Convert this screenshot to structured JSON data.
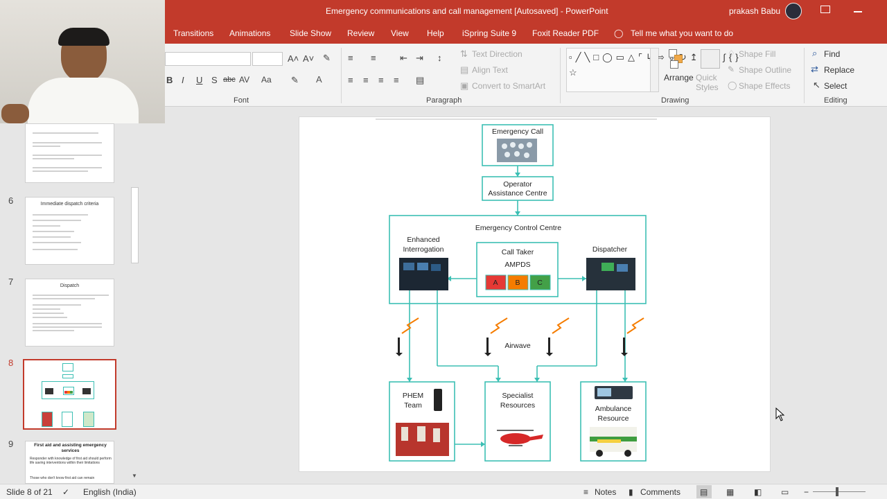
{
  "window": {
    "title": "Emergency communications and call management [Autosaved]  -  PowerPoint",
    "user": "prakash Babu"
  },
  "tabs": [
    "Transitions",
    "Animations",
    "Slide Show",
    "Review",
    "View",
    "Help",
    "iSpring Suite 9",
    "Foxit Reader PDF"
  ],
  "tell_me": "Tell me what you want to do",
  "ribbon": {
    "font_group": "Font",
    "paragraph_group": "Paragraph",
    "drawing_group": "Drawing",
    "editing_group": "Editing",
    "text_direction": "Text Direction",
    "align_text": "Align Text",
    "convert_smartart": "Convert to SmartArt",
    "arrange": "Arrange",
    "quick_styles": "Quick Styles",
    "shape_fill": "Shape Fill",
    "shape_outline": "Shape Outline",
    "shape_effects": "Shape Effects",
    "find": "Find",
    "replace": "Replace",
    "select": "Select",
    "bold": "B",
    "italic": "I",
    "underline": "U",
    "strike": "S",
    "abc": "abc",
    "spacing": "AV",
    "case": "Aa"
  },
  "thumbnails": {
    "numbers": [
      "6",
      "7",
      "8",
      "9"
    ],
    "slide6_title": "Immediate dispatch criteria",
    "slide7_title": "Dispatch",
    "slide9_title": "First aid and assisting emergency services",
    "slide9_bullet1": "Responder with knowledge of first aid should perform life saving interventions within their limitations",
    "slide9_bullet2": "Those who don't know first aid can remain"
  },
  "diagram": {
    "emergency_call": "Emergency Call",
    "operator_1": "Operator",
    "operator_2": "Assistance Centre",
    "ecc": "Emergency Control Centre",
    "enhanced_1": "Enhanced",
    "enhanced_2": "Interrogation",
    "call_taker": "Call Taker",
    "ampds": "AMPDS",
    "cat_a": "A",
    "cat_b": "B",
    "cat_c": "C",
    "dispatcher": "Dispatcher",
    "airwave": "Airwave",
    "phem_1": "PHEM",
    "phem_2": "Team",
    "specialist_1": "Specialist",
    "specialist_2": "Resources",
    "ambulance_1": "Ambulance",
    "ambulance_2": "Resource"
  },
  "statusbar": {
    "slide": "Slide 8 of 21",
    "language": "English (India)",
    "notes": "Notes",
    "comments": "Comments"
  },
  "colors": {
    "accent": "#c23a2b",
    "teal": "#3cbfb4",
    "cat_a": "#e53935",
    "cat_b": "#f57c00",
    "cat_c": "#43a047"
  }
}
